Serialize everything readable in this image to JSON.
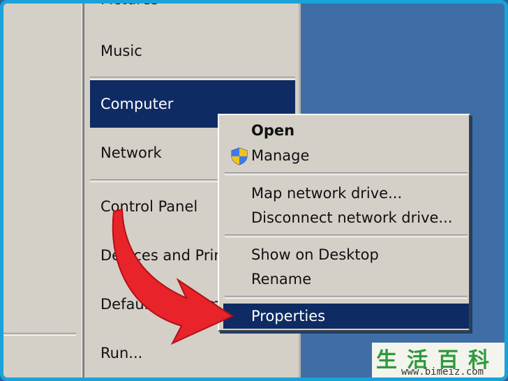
{
  "start_menu": {
    "items": [
      {
        "label": "Pictures",
        "state": "partially_visible"
      },
      {
        "label": "Music"
      },
      {
        "label": "Computer",
        "state": "selected"
      },
      {
        "label": "Network"
      },
      {
        "label": "Control Panel"
      },
      {
        "label": "Devices and Printers",
        "state": "partially_visible"
      },
      {
        "label": "Default Programs",
        "state": "partially_visible"
      },
      {
        "label": "Run..."
      }
    ]
  },
  "context_menu": {
    "items": [
      {
        "label": "Open",
        "bold": true
      },
      {
        "label": "Manage",
        "icon": "uac-shield-icon"
      },
      {
        "label": "Map network drive..."
      },
      {
        "label": "Disconnect network drive..."
      },
      {
        "label": "Show on Desktop"
      },
      {
        "label": "Rename"
      },
      {
        "label": "Properties",
        "state": "highlighted"
      }
    ]
  },
  "overlay": {
    "arrow_color": "#e8232a"
  },
  "watermark": {
    "title": "生活百科",
    "url": "www.bimeiz.com"
  },
  "colors": {
    "desktop_blue": "#3e6ea5",
    "menu_gray": "#d4d0c8",
    "selection_navy": "#0e2b63",
    "frame_border": "#1aa3d9"
  }
}
